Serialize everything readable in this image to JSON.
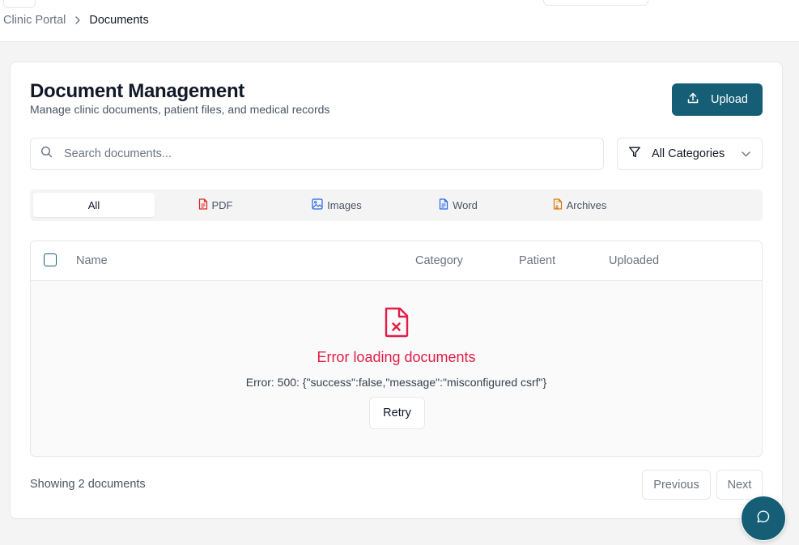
{
  "breadcrumb": {
    "root": "Clinic Portal",
    "current": "Documents"
  },
  "page": {
    "title": "Document Management",
    "subtitle": "Manage clinic documents, patient files, and medical records",
    "upload_label": "Upload"
  },
  "search": {
    "placeholder": "Search documents...",
    "value": ""
  },
  "filter": {
    "selected": "All Categories"
  },
  "tabs": [
    {
      "label": "All",
      "icon": "none",
      "active": true
    },
    {
      "label": "PDF",
      "icon": "pdf-file-icon",
      "color": "#dc2626"
    },
    {
      "label": "Images",
      "icon": "image-icon",
      "color": "#2563eb"
    },
    {
      "label": "Word",
      "icon": "word-file-icon",
      "color": "#2563eb"
    },
    {
      "label": "Archives",
      "icon": "archive-file-icon",
      "color": "#d97706"
    }
  ],
  "table": {
    "columns": [
      "Name",
      "Category",
      "Patient",
      "Uploaded"
    ],
    "error": {
      "title": "Error loading documents",
      "message": "Error: 500: {\"success\":false,\"message\":\"misconfigured csrf\"}",
      "retry_label": "Retry"
    }
  },
  "footer": {
    "count_text": "Showing 2 documents",
    "previous_label": "Previous",
    "next_label": "Next"
  },
  "colors": {
    "primary": "#155e75",
    "error": "#e11d48"
  }
}
